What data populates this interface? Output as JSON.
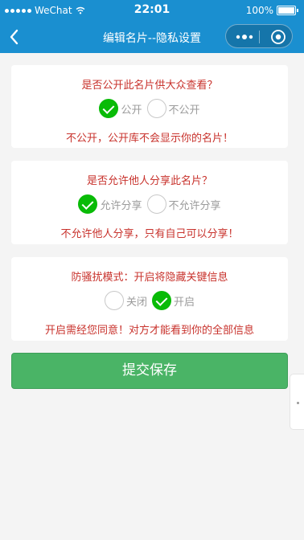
{
  "status_bar": {
    "carrier": "WeChat",
    "time": "22:01",
    "battery": "100%"
  },
  "nav": {
    "title": "编辑名片--隐私设置"
  },
  "sections": [
    {
      "question": "是否公开此名片供大众查看？",
      "options": [
        {
          "label": "公开",
          "checked": true
        },
        {
          "label": "不公开",
          "checked": false
        }
      ],
      "note": "不公开，公开库不会显示你的名片！"
    },
    {
      "question": "是否允许他人分享此名片？",
      "options": [
        {
          "label": "允许分享",
          "checked": true
        },
        {
          "label": "不允许分享",
          "checked": false
        }
      ],
      "note": "不允许他人分享，只有自己可以分享！"
    },
    {
      "question": "防骚扰模式：开启将隐藏关键信息",
      "options": [
        {
          "label": "关闭",
          "checked": false
        },
        {
          "label": "开启",
          "checked": true
        }
      ],
      "note": "开启需经您同意！对方才能看到你的全部信息"
    }
  ],
  "submit_label": "提交保存",
  "colors": {
    "accent": "#1a8fd0",
    "warning_text": "#c8322c",
    "check_green": "#09bb07",
    "button_green": "#4ab466"
  },
  "icons": {
    "back": "chevron-left-icon",
    "more": "more-dots-icon",
    "close": "miniprogram-close-icon",
    "wifi": "wifi-icon",
    "battery": "battery-icon"
  }
}
